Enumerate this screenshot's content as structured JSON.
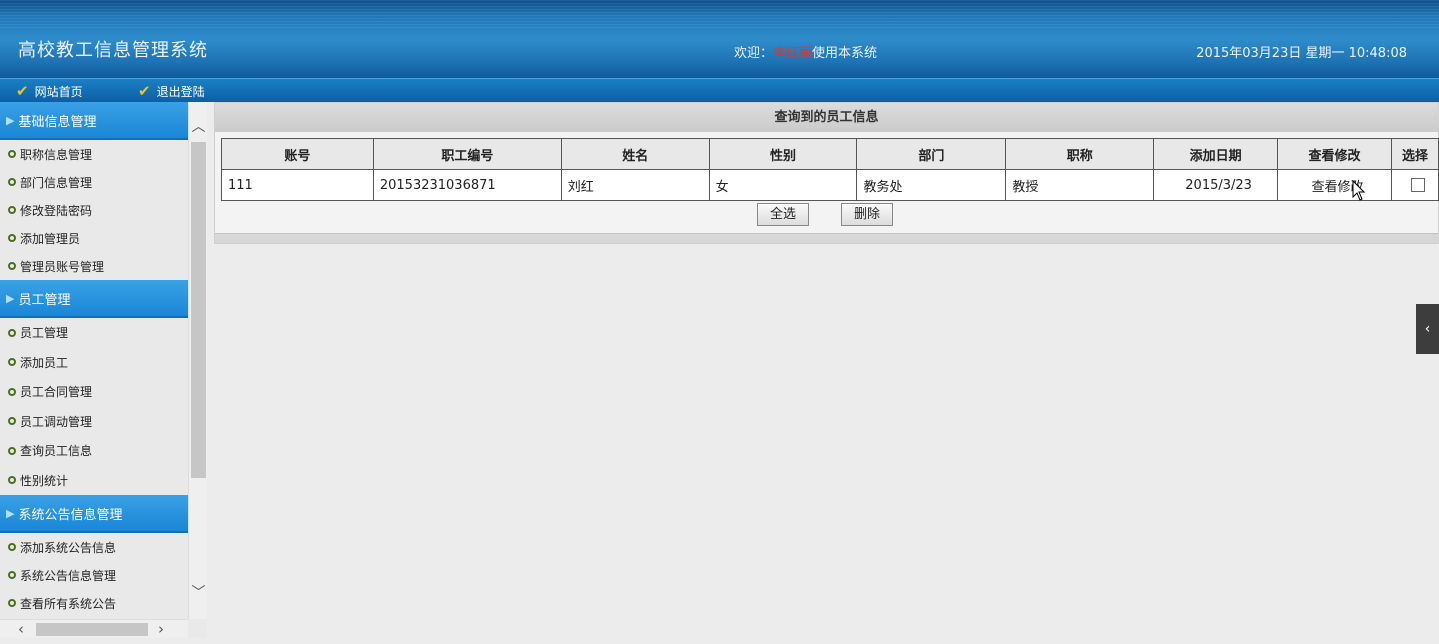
{
  "header": {
    "system_title": "高校教工信息管理系统",
    "welcome_prefix": "欢迎：",
    "welcome_user": "李红丽",
    "welcome_suffix": "使用本系统",
    "datetime": "2015年03月23日 星期一 10:48:08"
  },
  "nav": {
    "home": "网站首页",
    "logout": "退出登陆"
  },
  "sidebar": {
    "sections": [
      {
        "title": "基础信息管理",
        "items": [
          "职称信息管理",
          "部门信息管理",
          "修改登陆密码",
          "添加管理员",
          "管理员账号管理"
        ]
      },
      {
        "title": "员工管理",
        "items": [
          "员工管理",
          "添加员工",
          "员工合同管理",
          "员工调动管理",
          "查询员工信息",
          "性别统计"
        ]
      },
      {
        "title": "系统公告信息管理",
        "items": [
          "添加系统公告信息",
          "系统公告信息管理",
          "查看所有系统公告"
        ]
      }
    ]
  },
  "main": {
    "panel_title": "查询到的员工信息",
    "columns": [
      "账号",
      "职工编号",
      "姓名",
      "性别",
      "部门",
      "职称",
      "添加日期",
      "查看修改",
      "选择"
    ],
    "rows": [
      {
        "account": "111",
        "employee_no": "20153231036871",
        "name": "刘红",
        "gender": "女",
        "department": "教务处",
        "title": "教授",
        "added_date": "2015/3/23",
        "view_edit": "查看修改"
      }
    ],
    "select_all_label": "全选",
    "delete_label": "删除"
  },
  "icons": {
    "nav": "check-icon",
    "section": "triangle-right-icon",
    "item": "circle-bullet-icon",
    "side_toggle": "chevron-left-icon"
  },
  "colors": {
    "header_blue": "#1f76b6",
    "section_blue": "#1a86d6",
    "username_red": "#d23a3a",
    "check_yellow": "#f3c316"
  }
}
